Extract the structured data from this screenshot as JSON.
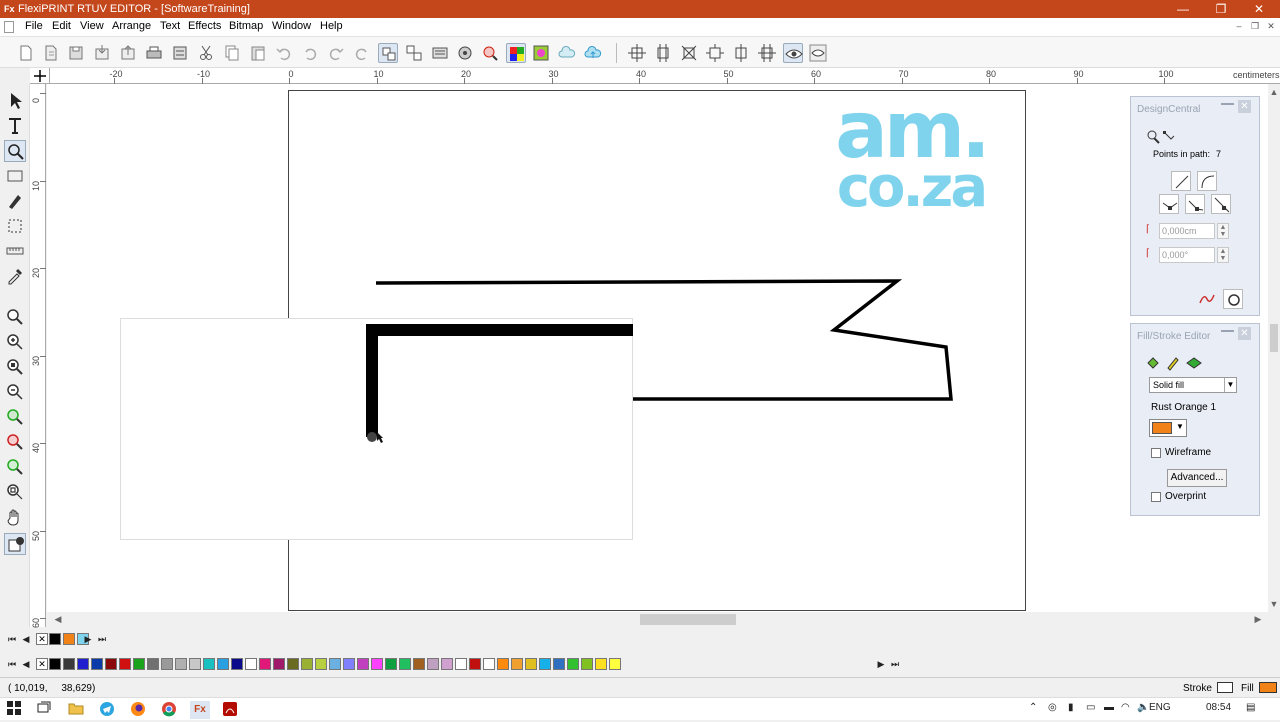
{
  "app": {
    "icon_label": "Fx",
    "title": "FlexiPRINT RTUV EDITOR - [SoftwareTraining]",
    "controls": {
      "minimize": "—",
      "maximize": "❐",
      "close": "✕"
    }
  },
  "menu": {
    "items": [
      "File",
      "Edit",
      "View",
      "Arrange",
      "Text",
      "Effects",
      "Bitmap",
      "Window",
      "Help"
    ],
    "mdi_controls": {
      "minimize": "–",
      "restore": "❐",
      "close": "✕"
    }
  },
  "ruler": {
    "unit": "centimeters",
    "h_labels": [
      "-20",
      "-10",
      "0",
      "10",
      "20",
      "30",
      "40",
      "50",
      "60",
      "70",
      "80",
      "90",
      "100"
    ],
    "v_labels": [
      "0",
      "10",
      "20",
      "30",
      "40",
      "50",
      "60"
    ]
  },
  "canvas": {
    "logo_line1": "am.",
    "logo_line2": "co.za",
    "logo_color": "#7fd3ec"
  },
  "design_central": {
    "title": "DesignCentral",
    "points_label": "Points in path:",
    "points_value": "7",
    "width_value": "0,000cm",
    "angle_value": "0,000°"
  },
  "fill_stroke": {
    "title": "Fill/Stroke Editor",
    "fill_type": "Solid fill",
    "color_name": "Rust Orange 1",
    "color_hex": "#f08218",
    "wireframe_label": "Wireframe",
    "advanced_label": "Advanced...",
    "overprint_label": "Overprint"
  },
  "palette": {
    "row1": [
      "#000000",
      "#f08218",
      "#7fd3ec"
    ],
    "row2": [
      "#000000",
      "#3a3a3a",
      "#1f1fd0",
      "#0a3aa8",
      "#8a0a0a",
      "#d01010",
      "#1aa21a",
      "#707070",
      "#9a9a9a",
      "#b0b0b0",
      "#c8c8c8",
      "#18c0c0",
      "#2aa0e0",
      "#0a0a8a",
      "#ffffff",
      "#e0187a",
      "#a01a6a",
      "#6a6a20",
      "#9ab030",
      "#b8d040",
      "#6ab0e0",
      "#8080ff",
      "#c040c0",
      "#ff40ff",
      "#10a040",
      "#20c060",
      "#a06020",
      "#c0a0c0",
      "#d0a0d0",
      "#ffffff",
      "#c01010",
      "#ffffff",
      "#ff8a10",
      "#f0a030",
      "#e0c020",
      "#18b0e8",
      "#3070c0",
      "#30c030",
      "#80c020",
      "#ffe020",
      "#ffff40"
    ]
  },
  "status": {
    "coords": "( 10,019,     38,629)",
    "stroke_label": "Stroke",
    "fill_label": "Fill",
    "fill_color": "#f08218"
  },
  "taskbar": {
    "language": "ENG",
    "time": "08:54"
  }
}
